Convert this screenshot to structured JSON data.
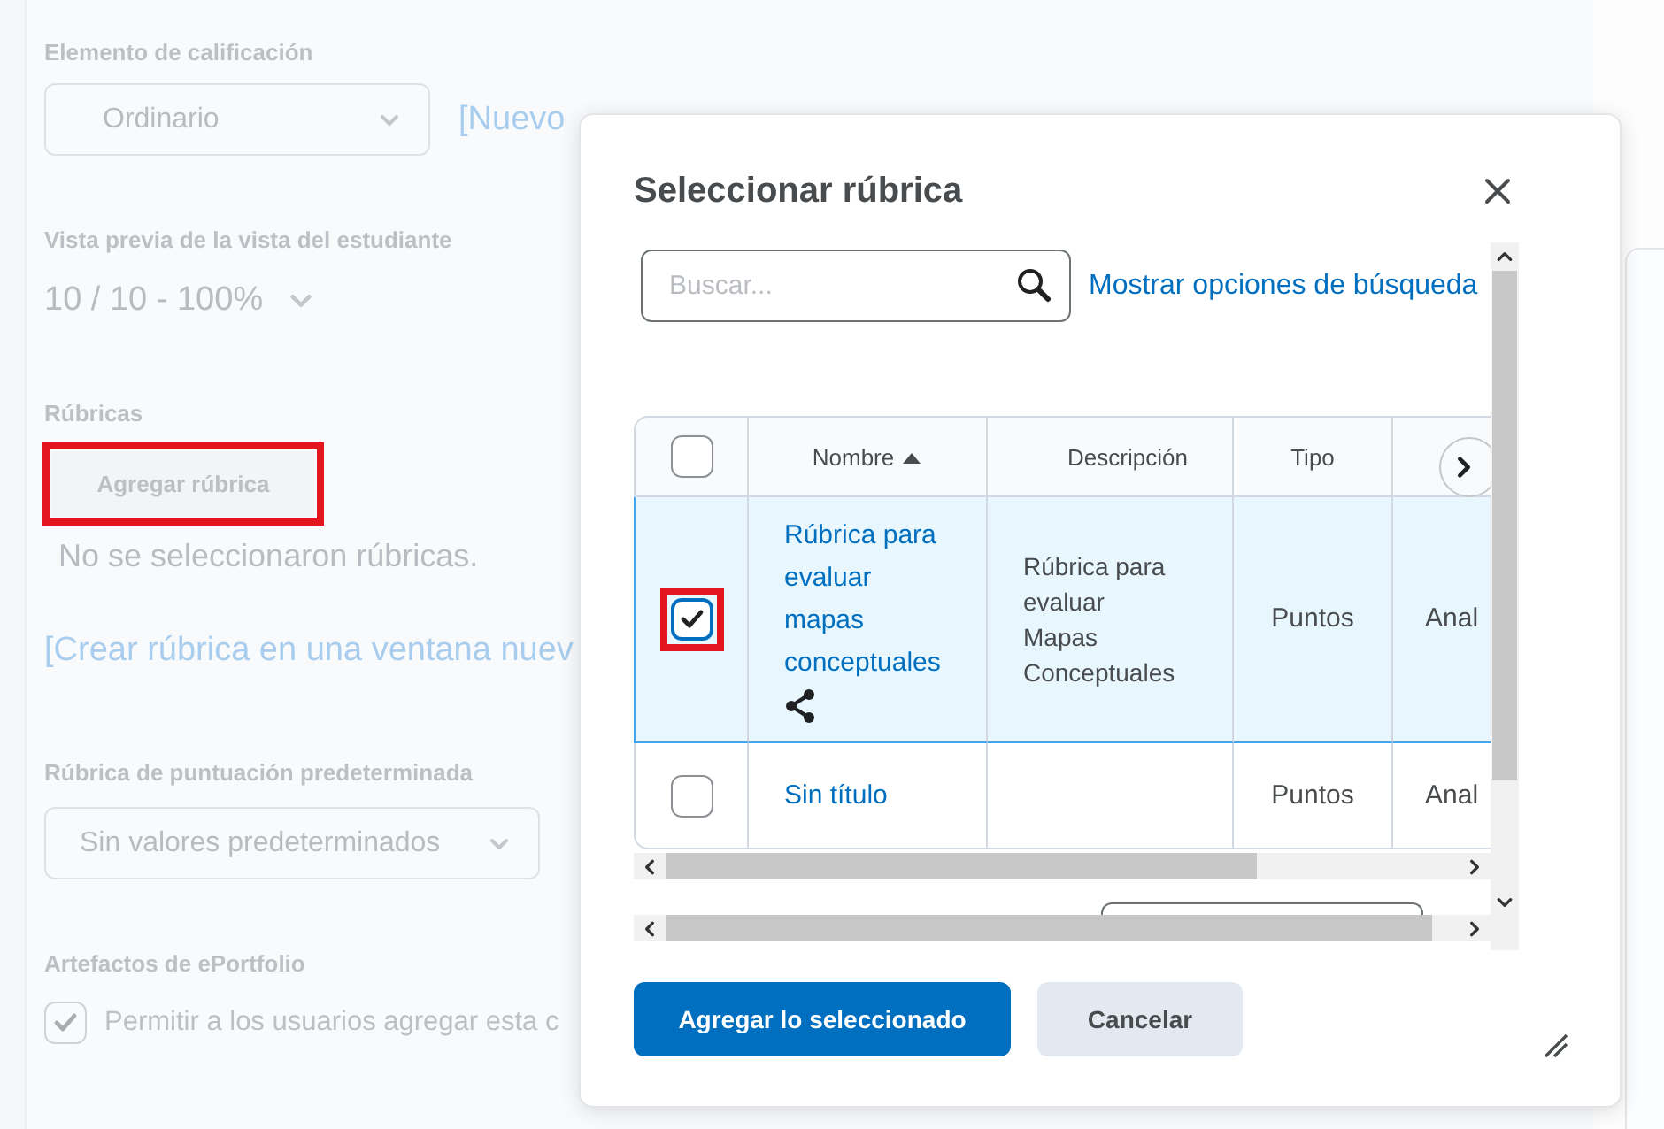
{
  "page": {
    "grade_item": {
      "label": "Elemento de calificación",
      "value": "Ordinario",
      "link": "[Nuevo"
    },
    "student_preview": {
      "label": "Vista previa de la vista del estudiante",
      "value": "10 / 10 - 100%"
    },
    "rubrics": {
      "label": "Rúbricas",
      "button": {
        "label": "Agregar rúbrica",
        "highlighted": true
      },
      "empty_message": "No se seleccionaron rúbricas.",
      "link": "[Crear rúbrica en una ventana nuev"
    },
    "default_rubric": {
      "label": "Rúbrica de puntuación predeterminada",
      "value": "Sin valores predeterminados"
    },
    "eportfolio": {
      "label": "Artefactos de ePortfolio",
      "checkbox": {
        "label": "Permitir a los usuarios agregar esta c",
        "checked": true
      }
    }
  },
  "dialog": {
    "title": "Seleccionar rúbrica",
    "search": {
      "placeholder": "Buscar..."
    },
    "search_options_link": "Mostrar opciones de búsqueda",
    "table": {
      "select_all": {
        "checked": false
      },
      "columns": [
        {
          "label": "Nombre",
          "sorted": true
        },
        {
          "label": "Descripción",
          "sorted": false
        },
        {
          "label": "Tipo",
          "sorted": false
        }
      ],
      "rows": [
        {
          "selected": true,
          "checked": true,
          "highlighted": true,
          "name": "Rúbrica para evaluar mapas conceptuales",
          "shared": true,
          "description": "Rúbrica para evaluar Mapas Conceptuales",
          "type": "Puntos",
          "column_5": "Anal"
        },
        {
          "selected": false,
          "checked": false,
          "highlighted": false,
          "name": "Sin título",
          "shared": false,
          "type": "Puntos",
          "column_5": "Anal"
        }
      ]
    },
    "buttons": [
      {
        "label": "Agregar lo seleccionado",
        "kind": "primary"
      },
      {
        "label": "Cancelar",
        "kind": "secondary"
      }
    ]
  }
}
